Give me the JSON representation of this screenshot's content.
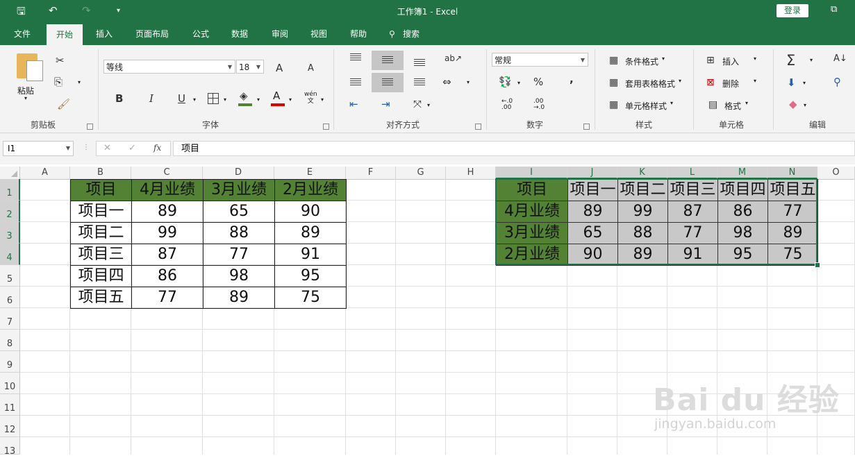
{
  "titlebar": {
    "title": "工作簿1  -  Excel",
    "login": "登录"
  },
  "tabs": [
    "文件",
    "开始",
    "插入",
    "页面布局",
    "公式",
    "数据",
    "审阅",
    "视图",
    "帮助",
    "搜索"
  ],
  "ribbon": {
    "clipboard": {
      "paste": "粘贴",
      "label": "剪贴板"
    },
    "font": {
      "name": "等线",
      "size": "18",
      "bold": "B",
      "italic": "I",
      "underline": "U",
      "label": "字体",
      "grow": "A",
      "shrink": "A",
      "wen": "wén\n文"
    },
    "alignment": {
      "label": "对齐方式"
    },
    "number": {
      "format": "常规",
      "percent": "%",
      "comma": ",",
      "label": "数字"
    },
    "styles": {
      "conditional": "条件格式",
      "table": "套用表格格式",
      "cell": "单元格样式",
      "label": "样式"
    },
    "cells": {
      "insert": "插入",
      "delete": "删除",
      "format": "格式",
      "label": "单元格"
    },
    "editing": {
      "label": "编辑"
    }
  },
  "formula_bar": {
    "name_box": "I1",
    "fx": "fx",
    "content": "项目"
  },
  "columns": [
    "A",
    "B",
    "C",
    "D",
    "E",
    "F",
    "G",
    "H",
    "I",
    "J",
    "K",
    "L",
    "M",
    "N",
    "O"
  ],
  "rows": [
    "1",
    "2",
    "3",
    "4",
    "5",
    "6",
    "7",
    "8",
    "9",
    "10",
    "11",
    "12",
    "13"
  ],
  "table1": {
    "header": [
      "项目",
      "4月业绩",
      "3月业绩",
      "2月业绩"
    ],
    "rows": [
      [
        "项目一",
        "89",
        "65",
        "90"
      ],
      [
        "项目二",
        "99",
        "88",
        "89"
      ],
      [
        "项目三",
        "87",
        "77",
        "91"
      ],
      [
        "项目四",
        "86",
        "98",
        "95"
      ],
      [
        "项目五",
        "77",
        "89",
        "75"
      ]
    ]
  },
  "table2": {
    "header": [
      "项目",
      "项目一",
      "项目二",
      "项目三",
      "项目四",
      "项目五"
    ],
    "rows": [
      [
        "4月业绩",
        "89",
        "99",
        "87",
        "86",
        "77"
      ],
      [
        "3月业绩",
        "65",
        "88",
        "77",
        "98",
        "89"
      ],
      [
        "2月业绩",
        "90",
        "89",
        "91",
        "95",
        "75"
      ]
    ]
  },
  "colors": {
    "excel_green": "#217346",
    "header_fill": "#548235",
    "selection_fill": "#c8c8c8"
  },
  "watermark": {
    "logo": "Bai du 经验",
    "url": "jingyan.baidu.com"
  }
}
